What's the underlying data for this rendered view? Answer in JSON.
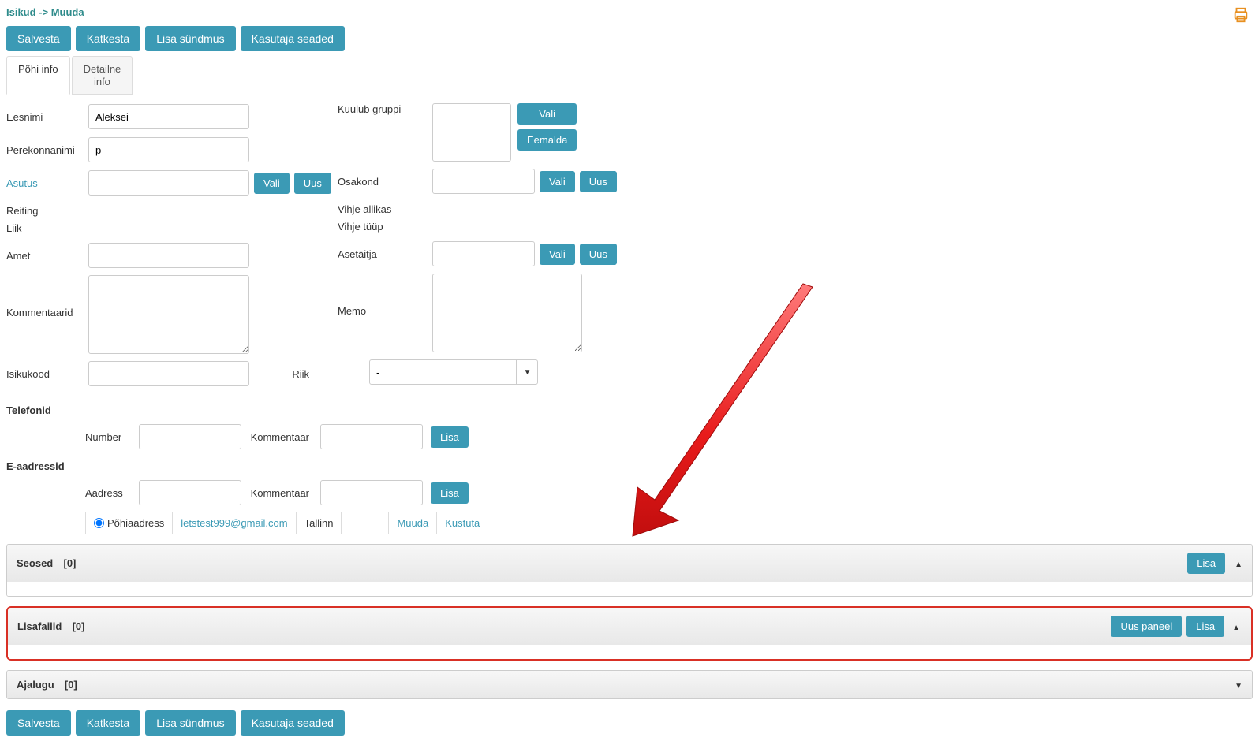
{
  "breadcrumb": "Isikud -> Muuda",
  "toolbar": {
    "save": "Salvesta",
    "cancel": "Katkesta",
    "add_event": "Lisa sündmus",
    "user_settings": "Kasutaja seaded"
  },
  "tabs": {
    "basic": "Põhi info",
    "detail": "Detailne\ninfo"
  },
  "labels": {
    "firstname": "Eesnimi",
    "lastname": "Perekonnanimi",
    "org": "Asutus",
    "rating": "Reiting",
    "kind": "Liik",
    "position": "Amet",
    "comments": "Kommentaarid",
    "personal_code": "Isikukood",
    "group": "Kuulub gruppi",
    "department": "Osakond",
    "hint_source": "Vihje allikas",
    "hint_type": "Vihje tüüp",
    "deputy": "Asetäitja",
    "memo": "Memo",
    "country": "Riik",
    "phones": "Telefonid",
    "number": "Number",
    "comment": "Kommentaar",
    "add": "Lisa",
    "emails": "E-aadressid",
    "address": "Aadress",
    "primary": "Põhiaadress",
    "edit": "Muuda",
    "delete": "Kustuta"
  },
  "buttons": {
    "select": "Vali",
    "new": "Uus",
    "remove": "Eemalda",
    "add": "Lisa",
    "new_panel": "Uus paneel"
  },
  "values": {
    "firstname": "Aleksei",
    "lastname": "p",
    "country": "-",
    "email": "letstest999@gmail.com",
    "email_city": "Tallinn"
  },
  "panels": {
    "relations": {
      "title": "Seosed",
      "count": "[0]"
    },
    "attachments": {
      "title": "Lisafailid",
      "count": "[0]"
    },
    "history": {
      "title": "Ajalugu",
      "count": "[0]"
    }
  }
}
